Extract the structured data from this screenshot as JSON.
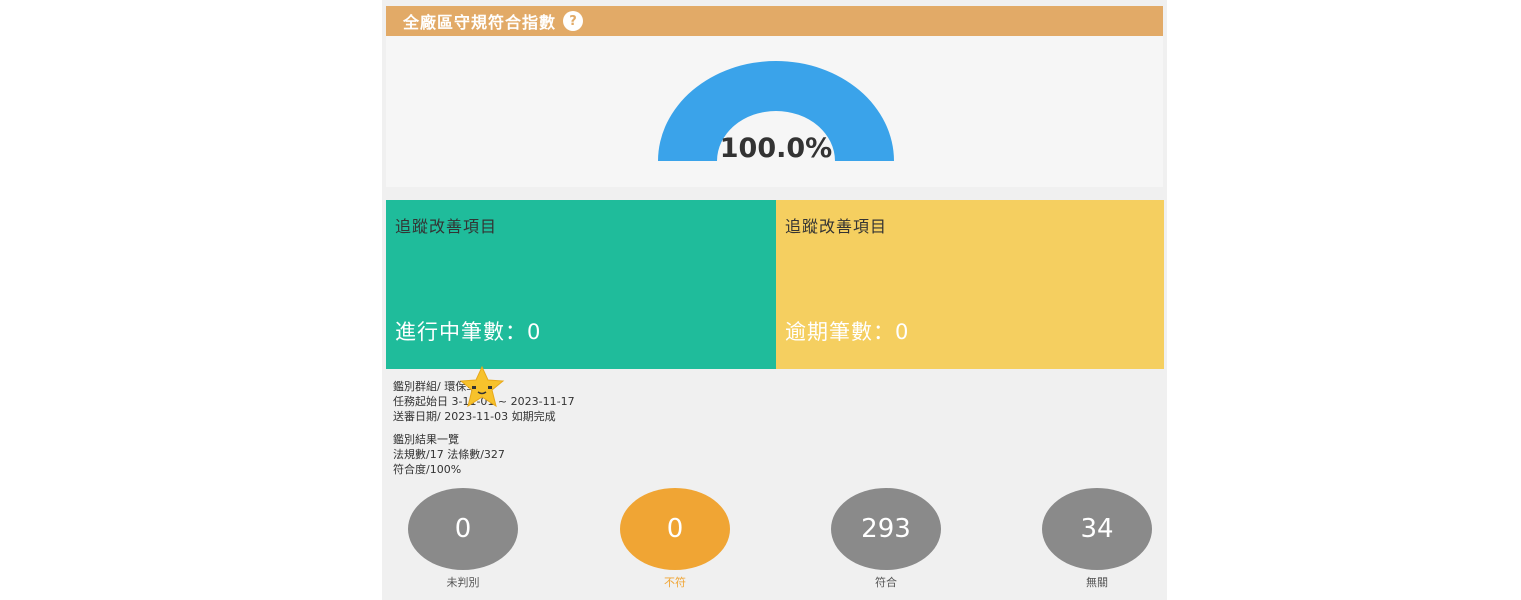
{
  "header": {
    "title": "全廠區守規符合指數",
    "help_icon": "?"
  },
  "gauge": {
    "value_text": "100.0%",
    "value_percent": 100,
    "color": "#3aa3ea"
  },
  "cards": {
    "tracking_in_progress": {
      "title": "追蹤改善項目",
      "count_label": "進行中筆數：0",
      "color": "#1fbc9b"
    },
    "tracking_overdue": {
      "title": "追蹤改善項目",
      "count_label": "逾期筆數：0",
      "color": "#f5cf60"
    }
  },
  "info": {
    "line1": "鑑別群組/     環保單位",
    "line2": "任務起始日     3-11-01 ~ 2023-11-17",
    "line3": "送審日期/ 2023-11-03 如期完成",
    "line4": "鑑別結果一覽",
    "line5": "法規數/17 法條數/327",
    "line6": "符合度/100%"
  },
  "summary": [
    {
      "value": "0",
      "label": "未判別",
      "color": "#8a8a8a"
    },
    {
      "value": "0",
      "label": "不符",
      "color": "#f0a534"
    },
    {
      "value": "293",
      "label": "符合",
      "color": "#8a8a8a"
    },
    {
      "value": "34",
      "label": "無關",
      "color": "#8a8a8a"
    }
  ]
}
